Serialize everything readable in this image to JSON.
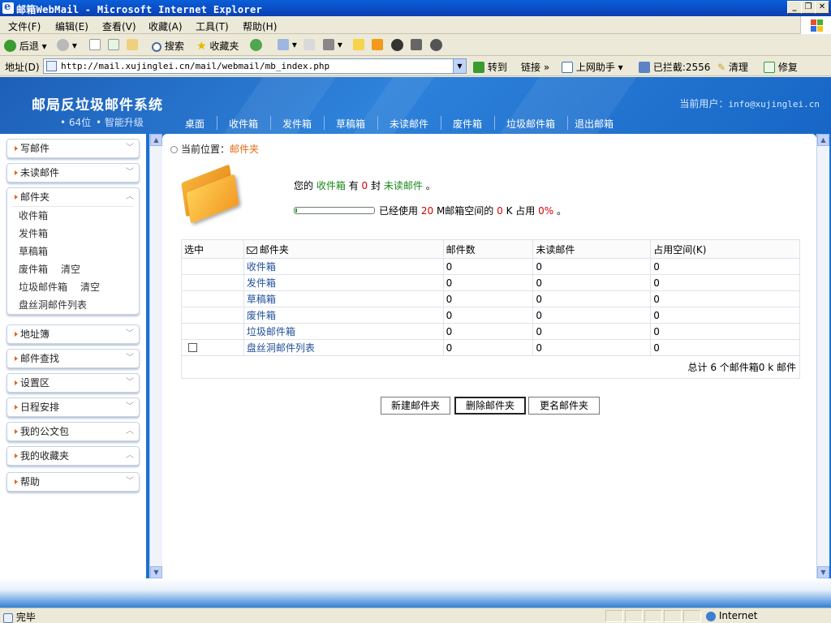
{
  "window": {
    "title": "邮箱WebMail - Microsoft Internet Explorer",
    "controls": {
      "minimize": "_",
      "restore": "❐",
      "close": "✕"
    }
  },
  "menubar": [
    "文件(F)",
    "编辑(E)",
    "查看(V)",
    "收藏(A)",
    "工具(T)",
    "帮助(H)"
  ],
  "toolbar": {
    "back": "后退",
    "search": "搜索",
    "favorites": "收藏夹"
  },
  "addressbar": {
    "label": "地址(D)",
    "url": "http://mail.xujinglei.cn/mail/webmail/mb_index.php",
    "go": "转到",
    "links": "链接",
    "assistant": "上网助手",
    "blocked": "已拦截:2556",
    "clean": "清理",
    "repair": "修复"
  },
  "banner": {
    "title": "邮局反垃圾邮件系统",
    "badge1": "• 64位",
    "badge2": "• 智能升级",
    "user_label": "当前用户：",
    "user_email": "info@xujinglei.cn"
  },
  "nav": [
    "桌面",
    "收件箱",
    "发件箱",
    "草稿箱",
    "未读邮件",
    "废件箱",
    "垃圾邮件箱",
    "退出邮箱"
  ],
  "sidebar": {
    "write": "写邮件",
    "unread": "未读邮件",
    "folders": "邮件夹",
    "folder_items": [
      {
        "label": "收件箱",
        "extra": ""
      },
      {
        "label": "发件箱",
        "extra": ""
      },
      {
        "label": "草稿箱",
        "extra": ""
      },
      {
        "label": "废件箱",
        "extra": "清空"
      },
      {
        "label": "垃圾邮件箱",
        "extra": "清空"
      },
      {
        "label": "盘丝洞邮件列表",
        "extra": ""
      }
    ],
    "addressbook": "地址簿",
    "search": "邮件查找",
    "settings": "设置区",
    "schedule": "日程安排",
    "briefcase": "我的公文包",
    "bookmarks": "我的收藏夹",
    "help": "帮助"
  },
  "main": {
    "breadcrumb_label": "当前位置：",
    "breadcrumb_current": "邮件夹",
    "summary": {
      "prefix": "您的",
      "inbox": "收件箱",
      "has": "有",
      "count": "0",
      "unit": "封",
      "unread": "未读邮件",
      "end": "。"
    },
    "usage": {
      "prefix": "已经使用",
      "total": "20",
      "mid": "M邮箱空间的",
      "used": "0",
      "mid2": "K 占用",
      "percent": "0%",
      "end": "。",
      "fill_fraction": 0.02
    },
    "table": {
      "headers": {
        "select": "选中",
        "folder": "邮件夹",
        "count": "邮件数",
        "unread": "未读邮件",
        "size": "占用空间(K)"
      },
      "rows": [
        {
          "name": "收件箱",
          "count": "0",
          "unread": "0",
          "size": "0"
        },
        {
          "name": "发件箱",
          "count": "0",
          "unread": "0",
          "size": "0"
        },
        {
          "name": "草稿箱",
          "count": "0",
          "unread": "0",
          "size": "0"
        },
        {
          "name": "废件箱",
          "count": "0",
          "unread": "0",
          "size": "0"
        },
        {
          "name": "垃圾邮件箱",
          "count": "0",
          "unread": "0",
          "size": "0"
        },
        {
          "name": "盘丝洞邮件列表",
          "count": "0",
          "unread": "0",
          "size": "0"
        }
      ],
      "total": "总计 6 个邮件箱0 k 邮件"
    },
    "buttons": {
      "new": "新建邮件夹",
      "delete": "删除邮件夹",
      "rename": "更名邮件夹"
    }
  },
  "statusbar": {
    "status": "完毕",
    "zone": "Internet"
  },
  "colors": {
    "accent": "#1B70D0",
    "highlight": "#E46A12",
    "green": "#1a8a1a",
    "red": "#D40000"
  }
}
